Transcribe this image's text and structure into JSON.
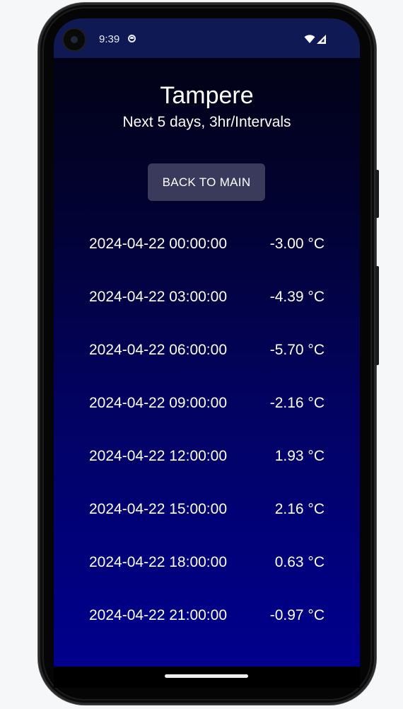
{
  "status_bar": {
    "time": "9:39"
  },
  "header": {
    "title": "Tampere",
    "subtitle": "Next 5 days, 3hr/Intervals"
  },
  "back_button": {
    "label": "BACK TO MAIN"
  },
  "forecast": [
    {
      "datetime": "2024-04-22 00:00:00",
      "temp": "-3.00 °C"
    },
    {
      "datetime": "2024-04-22 03:00:00",
      "temp": "-4.39 °C"
    },
    {
      "datetime": "2024-04-22 06:00:00",
      "temp": "-5.70 °C"
    },
    {
      "datetime": "2024-04-22 09:00:00",
      "temp": "-2.16 °C"
    },
    {
      "datetime": "2024-04-22 12:00:00",
      "temp": "1.93 °C"
    },
    {
      "datetime": "2024-04-22 15:00:00",
      "temp": "2.16 °C"
    },
    {
      "datetime": "2024-04-22 18:00:00",
      "temp": "0.63 °C"
    },
    {
      "datetime": "2024-04-22 21:00:00",
      "temp": "-0.97 °C"
    }
  ],
  "colors": {
    "status_bar": "#0f1a55",
    "button": "#393a5c",
    "bg_top": "#02020f",
    "bg_bottom": "#00008e"
  }
}
